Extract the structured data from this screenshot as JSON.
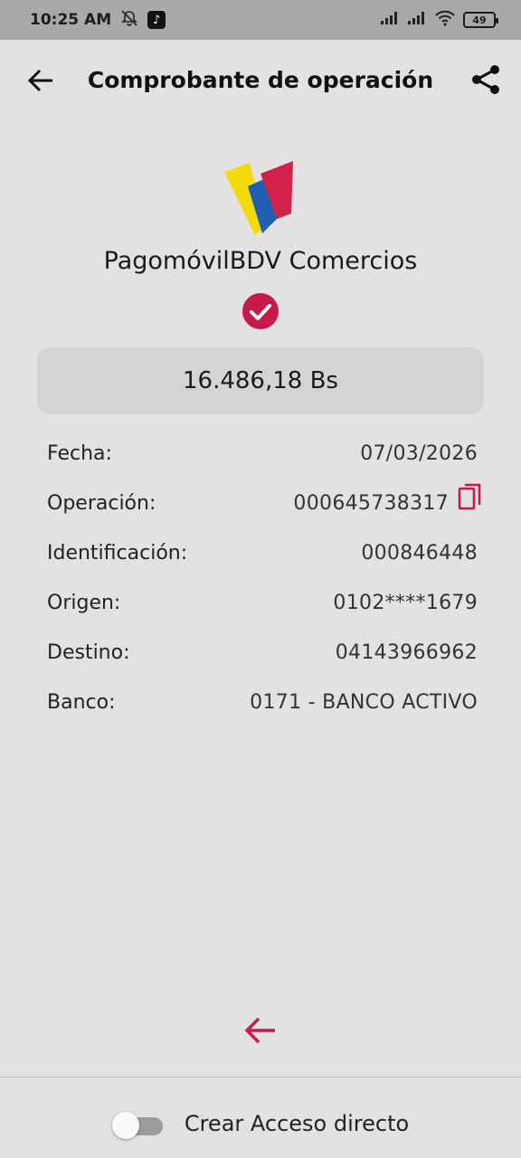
{
  "status_bar": {
    "time": "10:25 AM",
    "battery": "49",
    "icons": [
      "bell-off-icon",
      "tiktok-icon",
      "signal-icon",
      "signal-icon",
      "wifi-icon",
      "battery-icon"
    ]
  },
  "header": {
    "title": "Comprobante de operación",
    "back_icon": "arrow-left-icon",
    "share_icon": "share-icon"
  },
  "brand": {
    "name": "PagomóvilBDV Comercios",
    "logo_colors": [
      "#f5d90f",
      "#1e5fb0",
      "#d3224a"
    ],
    "status_icon": "check-circle-icon",
    "accent": "#c8194b"
  },
  "amount": "16.486,18 Bs",
  "details": [
    {
      "label": "Fecha:",
      "value": "07/03/2026",
      "copy": false
    },
    {
      "label": "Operación:",
      "value": "000645738317",
      "copy": true
    },
    {
      "label": "Identificación:",
      "value": "000846448",
      "copy": false
    },
    {
      "label": "Origen:",
      "value": "0102****1679",
      "copy": false
    },
    {
      "label": "Destino:",
      "value": "04143966962",
      "copy": false
    },
    {
      "label": "Banco:",
      "value": "0171 - BANCO ACTIVO",
      "copy": false
    }
  ],
  "bottom": {
    "back_icon": "arrow-left-icon",
    "shortcut_label": "Crear Acceso directo",
    "shortcut_enabled": false
  }
}
